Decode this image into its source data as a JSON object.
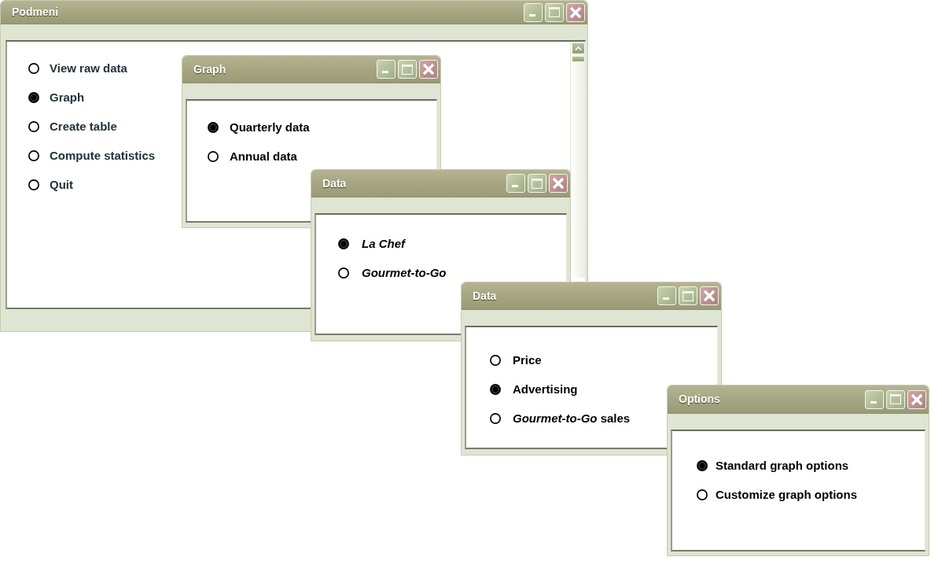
{
  "windows": [
    {
      "title": "Podmeni",
      "scrollbar": true,
      "italic": false,
      "options": [
        {
          "label": "View raw data",
          "selected": false
        },
        {
          "label": "Graph",
          "selected": true
        },
        {
          "label": "Create table",
          "selected": false
        },
        {
          "label": "Compute statistics",
          "selected": false
        },
        {
          "label": "Quit",
          "selected": false
        }
      ]
    },
    {
      "title": "Graph",
      "scrollbar": false,
      "italic": false,
      "options": [
        {
          "label": "Quarterly data",
          "selected": true
        },
        {
          "label": "Annual data",
          "selected": false
        }
      ]
    },
    {
      "title": "Data",
      "scrollbar": false,
      "italic": true,
      "options": [
        {
          "label": "La Chef",
          "selected": true
        },
        {
          "label": "Gourmet-to-Go",
          "selected": false
        }
      ]
    },
    {
      "title": "Data",
      "scrollbar": false,
      "italic": false,
      "options": [
        {
          "label": "Price",
          "selected": false
        },
        {
          "label": "Advertising",
          "selected": true
        },
        {
          "label": "*Gourmet-to-Go* sales",
          "selected": false
        }
      ]
    },
    {
      "title": "Options",
      "scrollbar": false,
      "italic": false,
      "options": [
        {
          "label": "Standard graph options",
          "selected": true
        },
        {
          "label": "Customize graph options",
          "selected": false
        }
      ]
    }
  ]
}
